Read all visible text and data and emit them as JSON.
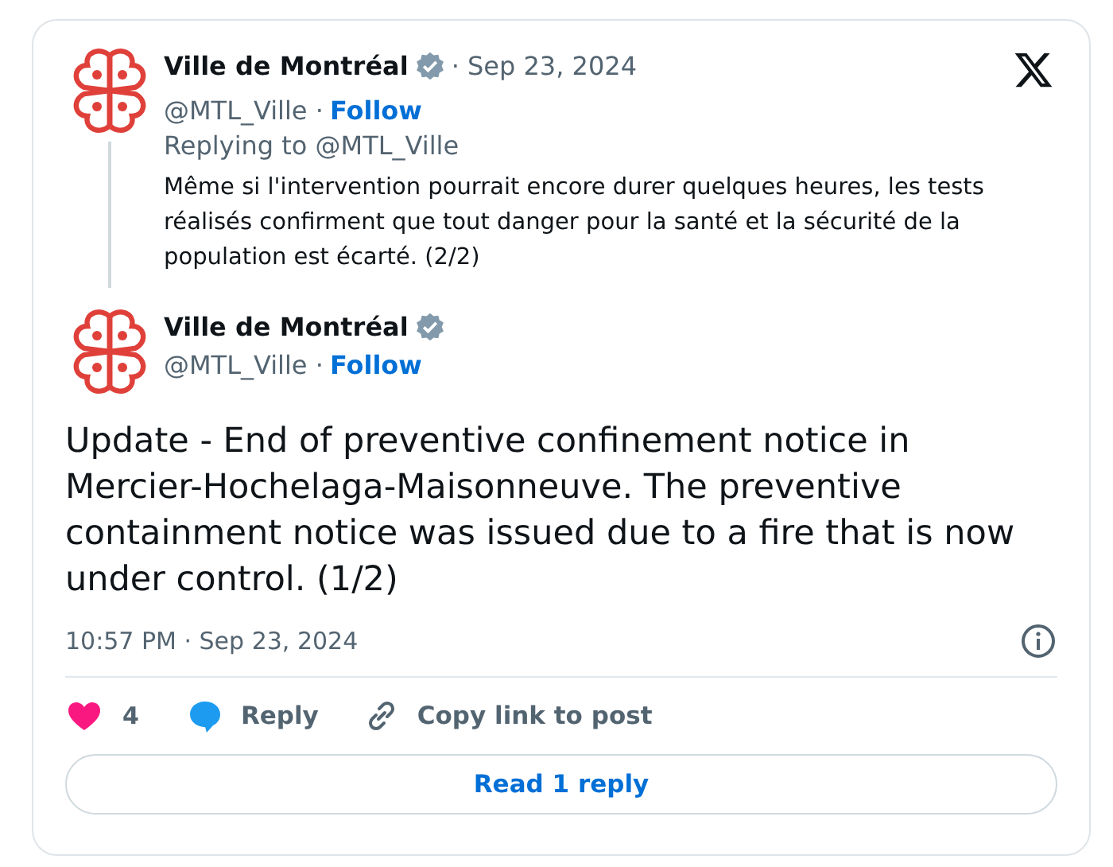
{
  "parent_post": {
    "author": "Ville de Montréal",
    "verified": true,
    "date": "· Sep 23, 2024",
    "handle": "@MTL_Ville ·",
    "follow": "Follow",
    "replying_to": "Replying to @MTL_Ville",
    "text": "Même si l'intervention pourrait encore durer quelques heures, les tests réalisés confirment que tout danger pour la santé et la sécurité de la population est écarté. (2/2)"
  },
  "post": {
    "author": "Ville de Montréal",
    "verified": true,
    "handle": "@MTL_Ville ·",
    "follow": "Follow",
    "text": "Update - End of preventive confinement notice in Mercier-Hochelaga-Maisonneuve. The preventive containment notice was issued due to a fire that is now under control. (1/2)",
    "timestamp": "10:57 PM · Sep 23, 2024"
  },
  "actions": {
    "liked": true,
    "like_count": "4",
    "reply": "Reply",
    "copy_link": "Copy link to post"
  },
  "read_replies": "Read 1 reply"
}
